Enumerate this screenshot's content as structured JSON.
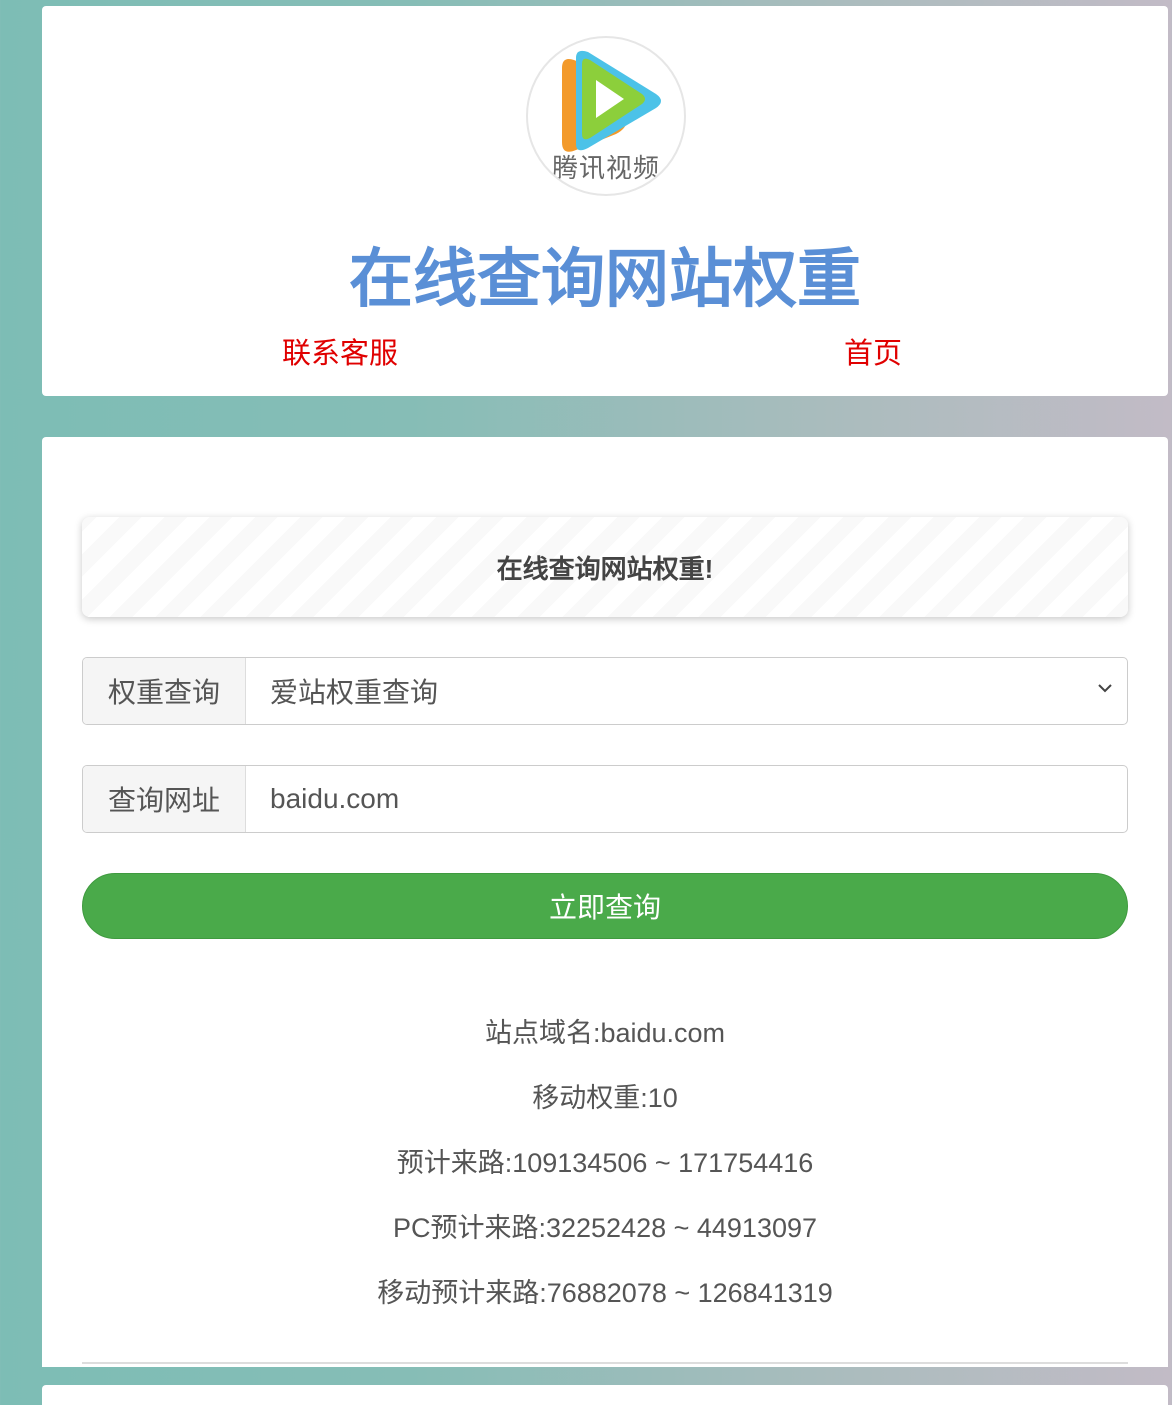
{
  "header": {
    "logo_text": "腾讯视频",
    "title": "在线查询网站权重",
    "nav": [
      {
        "label": "联系客服"
      },
      {
        "label": "首页"
      }
    ]
  },
  "main": {
    "banner_text": "在线查询网站权重!",
    "weight_query": {
      "label": "权重查询",
      "selected_option": "爱站权重查询"
    },
    "url_query": {
      "label": "查询网址",
      "value": "baidu.com"
    },
    "submit_label": "立即查询",
    "results": [
      "站点域名:baidu.com",
      "移动权重:10",
      "预计来路:109134506 ~ 171754416",
      "PC预计来路:32252428 ~ 44913097",
      "移动预计来路:76882078 ~ 126841319"
    ]
  },
  "colors": {
    "title": "#5a8fd6",
    "nav_link": "#e00000",
    "button": "#4aaa4a"
  },
  "icons": {
    "logo": "tencent-video-play-icon",
    "select_arrow": "chevron-down-icon"
  }
}
